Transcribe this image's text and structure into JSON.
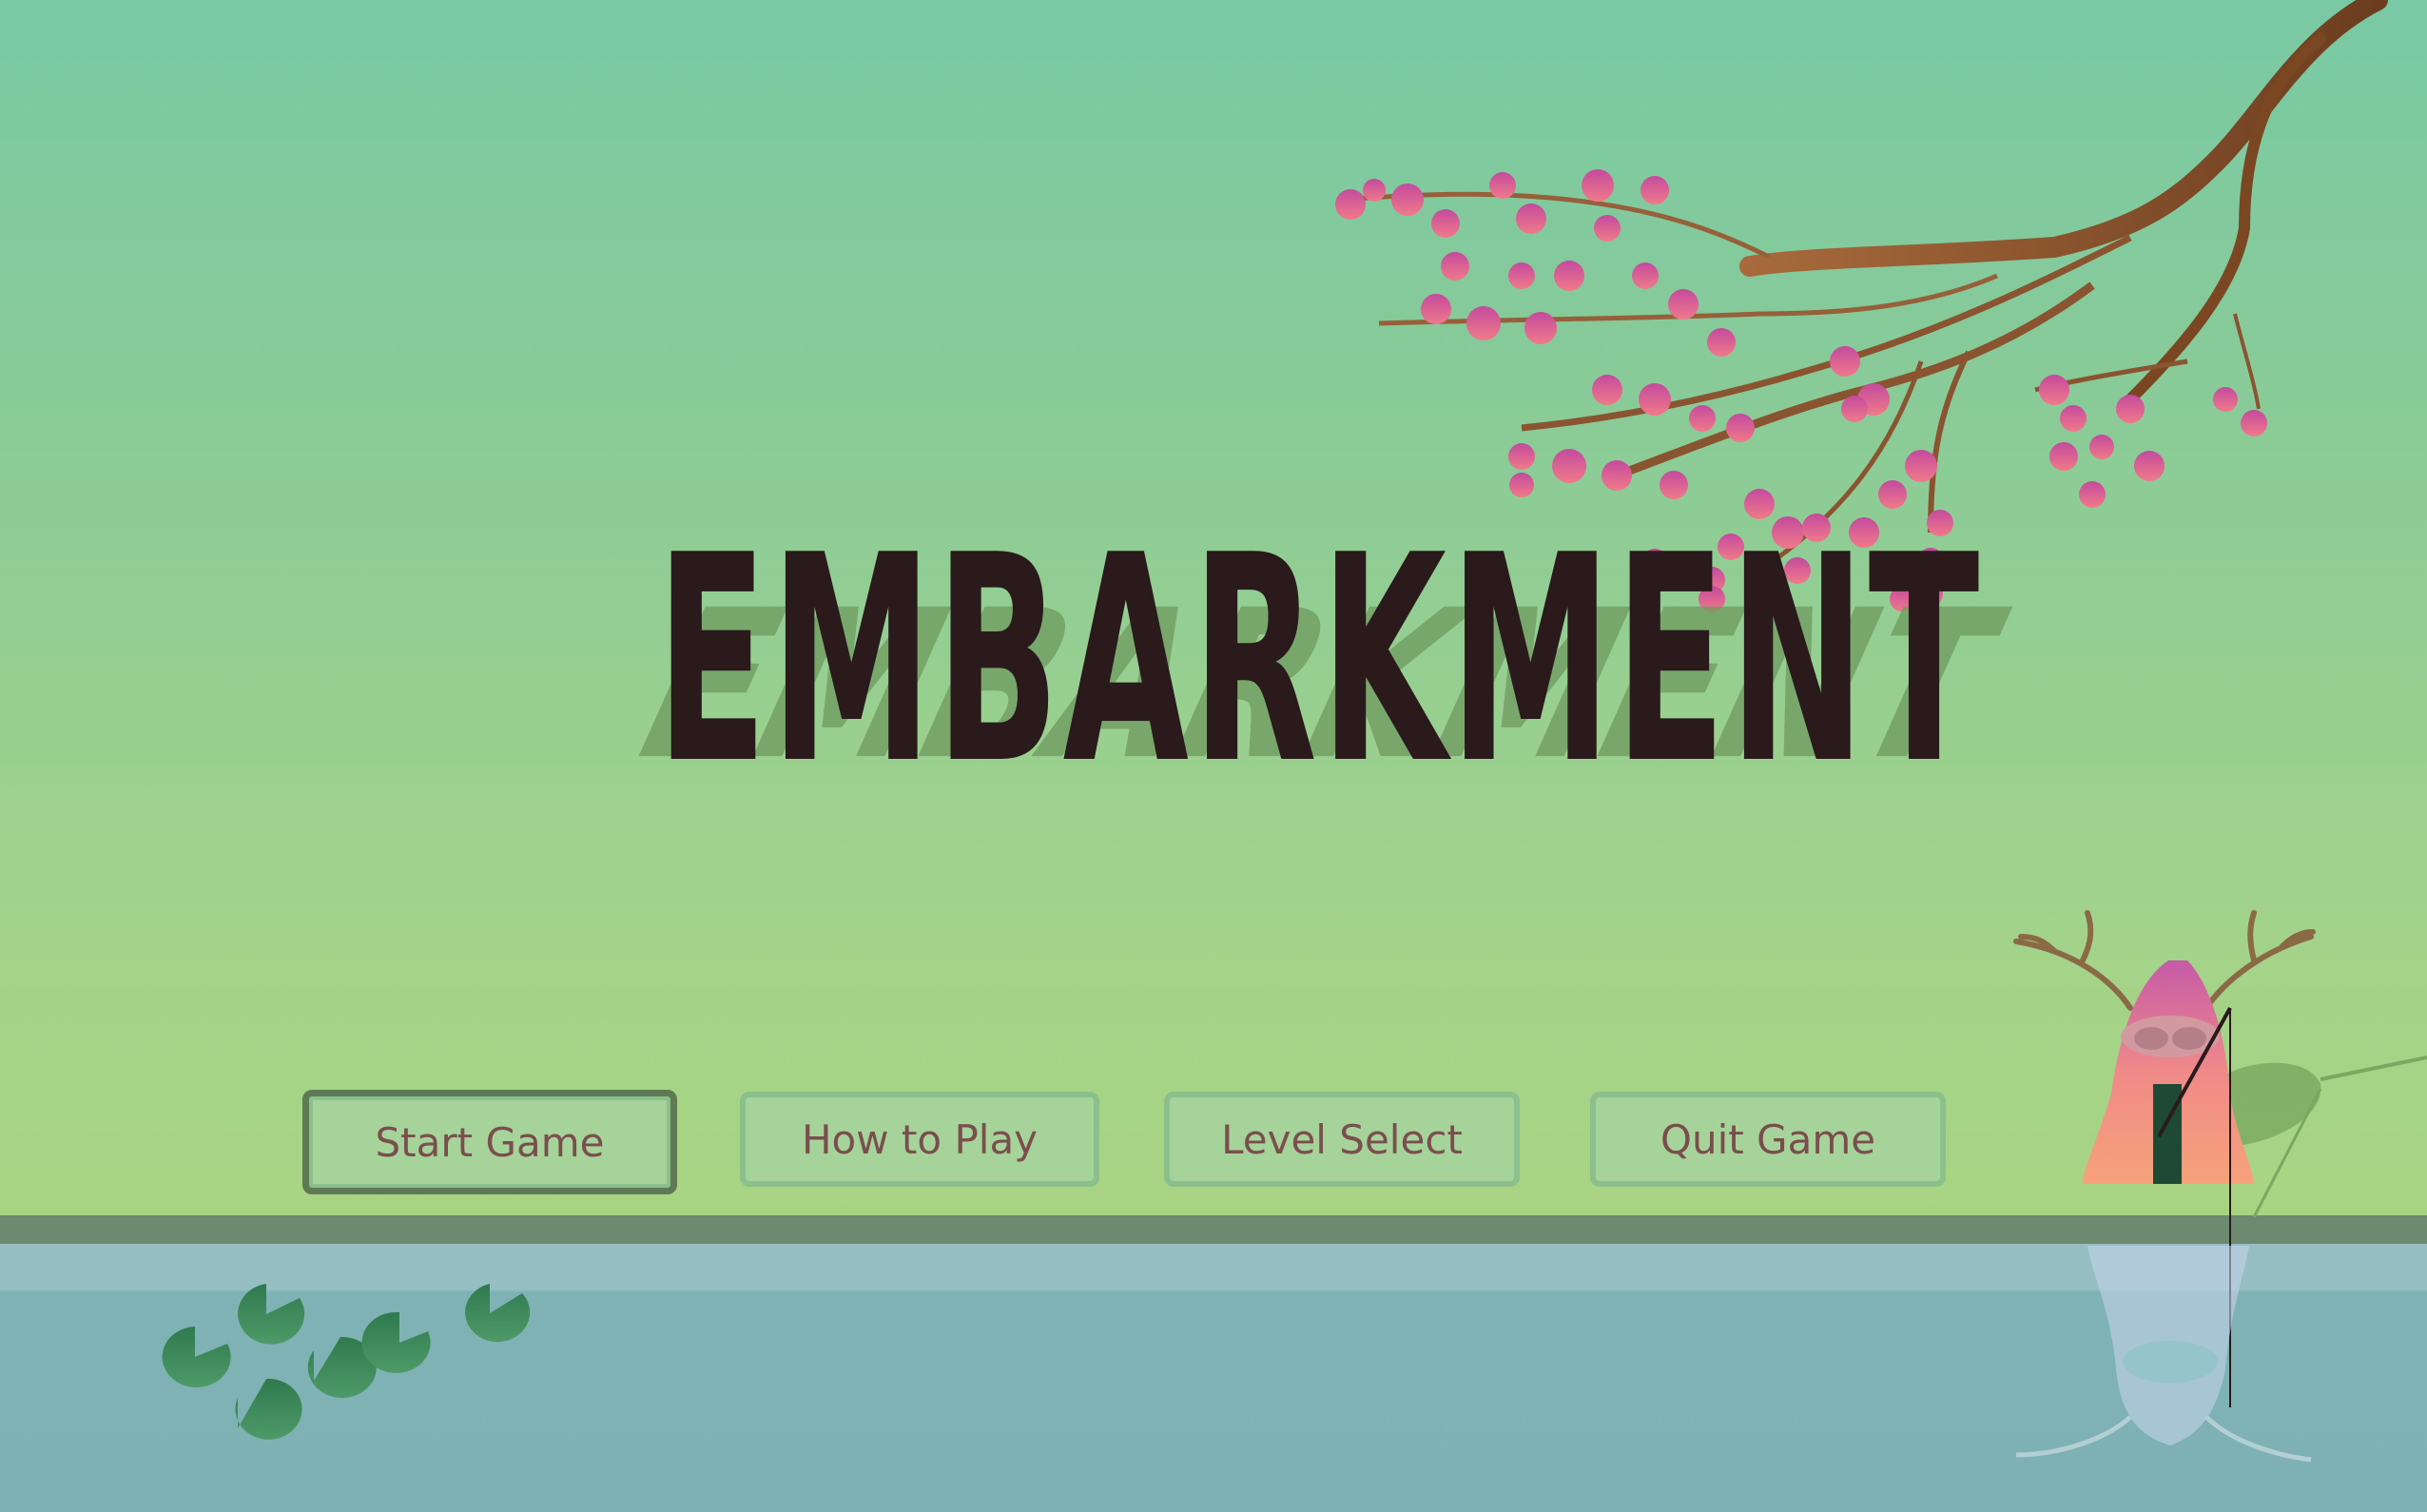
{
  "game": {
    "title": "EMBARKMENT"
  },
  "menu": {
    "start_label": "Start Game",
    "howto_label": "How to Play",
    "level_label": "Level Select",
    "quit_label": "Quit Game",
    "selected": "Start Game"
  },
  "colors": {
    "sky_top": "#79c9a4",
    "sky_bottom": "#aed57a",
    "water": "#7db1b3",
    "title": "#2a1a1c",
    "button_text": "#7a4e4e",
    "blossom": "#e0579a"
  },
  "icons": {
    "tree": "blossom-branch",
    "character": "antlered-hooded-fisher",
    "lily_pads": "lily-pad"
  }
}
